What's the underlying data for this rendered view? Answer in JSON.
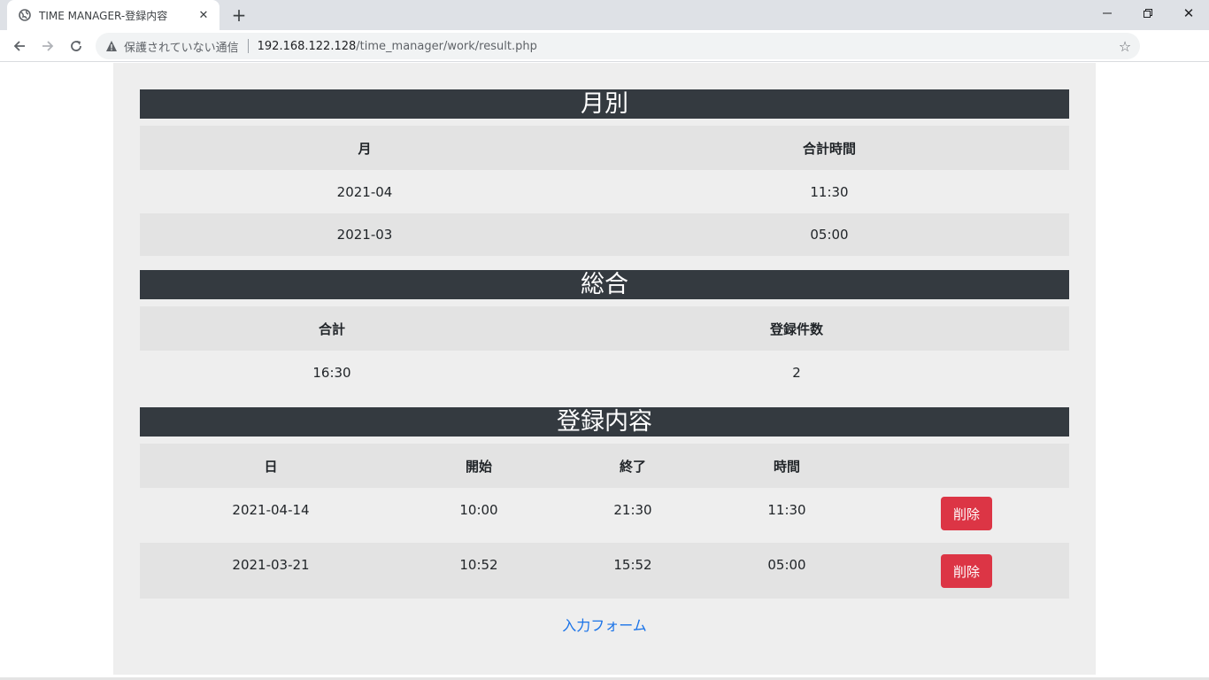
{
  "browser": {
    "tab_title": "TIME MANAGER-登録内容",
    "security_text": "保護されていない通信",
    "url_host": "192.168.122.128",
    "url_path": "/time_manager/work/result.php"
  },
  "monthly": {
    "heading": "月別",
    "columns": [
      "月",
      "合計時間"
    ],
    "rows": [
      [
        "2021-04",
        "11:30"
      ],
      [
        "2021-03",
        "05:00"
      ]
    ]
  },
  "total": {
    "heading": "総合",
    "columns": [
      "合計",
      "登録件数"
    ],
    "rows": [
      [
        "16:30",
        "2"
      ]
    ]
  },
  "entries": {
    "heading": "登録内容",
    "columns": [
      "日",
      "開始",
      "終了",
      "時間",
      ""
    ],
    "rows": [
      {
        "date": "2021-04-14",
        "start": "10:00",
        "end": "21:30",
        "duration": "11:30",
        "delete_label": "削除"
      },
      {
        "date": "2021-03-21",
        "start": "10:52",
        "end": "15:52",
        "duration": "05:00",
        "delete_label": "削除"
      }
    ]
  },
  "form_link": "入力フォーム",
  "colors": {
    "header_bg": "#343a40",
    "delete_btn": "#dc3545",
    "link": "#1a73e8",
    "container_bg": "#eeeeee",
    "stripe": "#e3e3e3"
  }
}
